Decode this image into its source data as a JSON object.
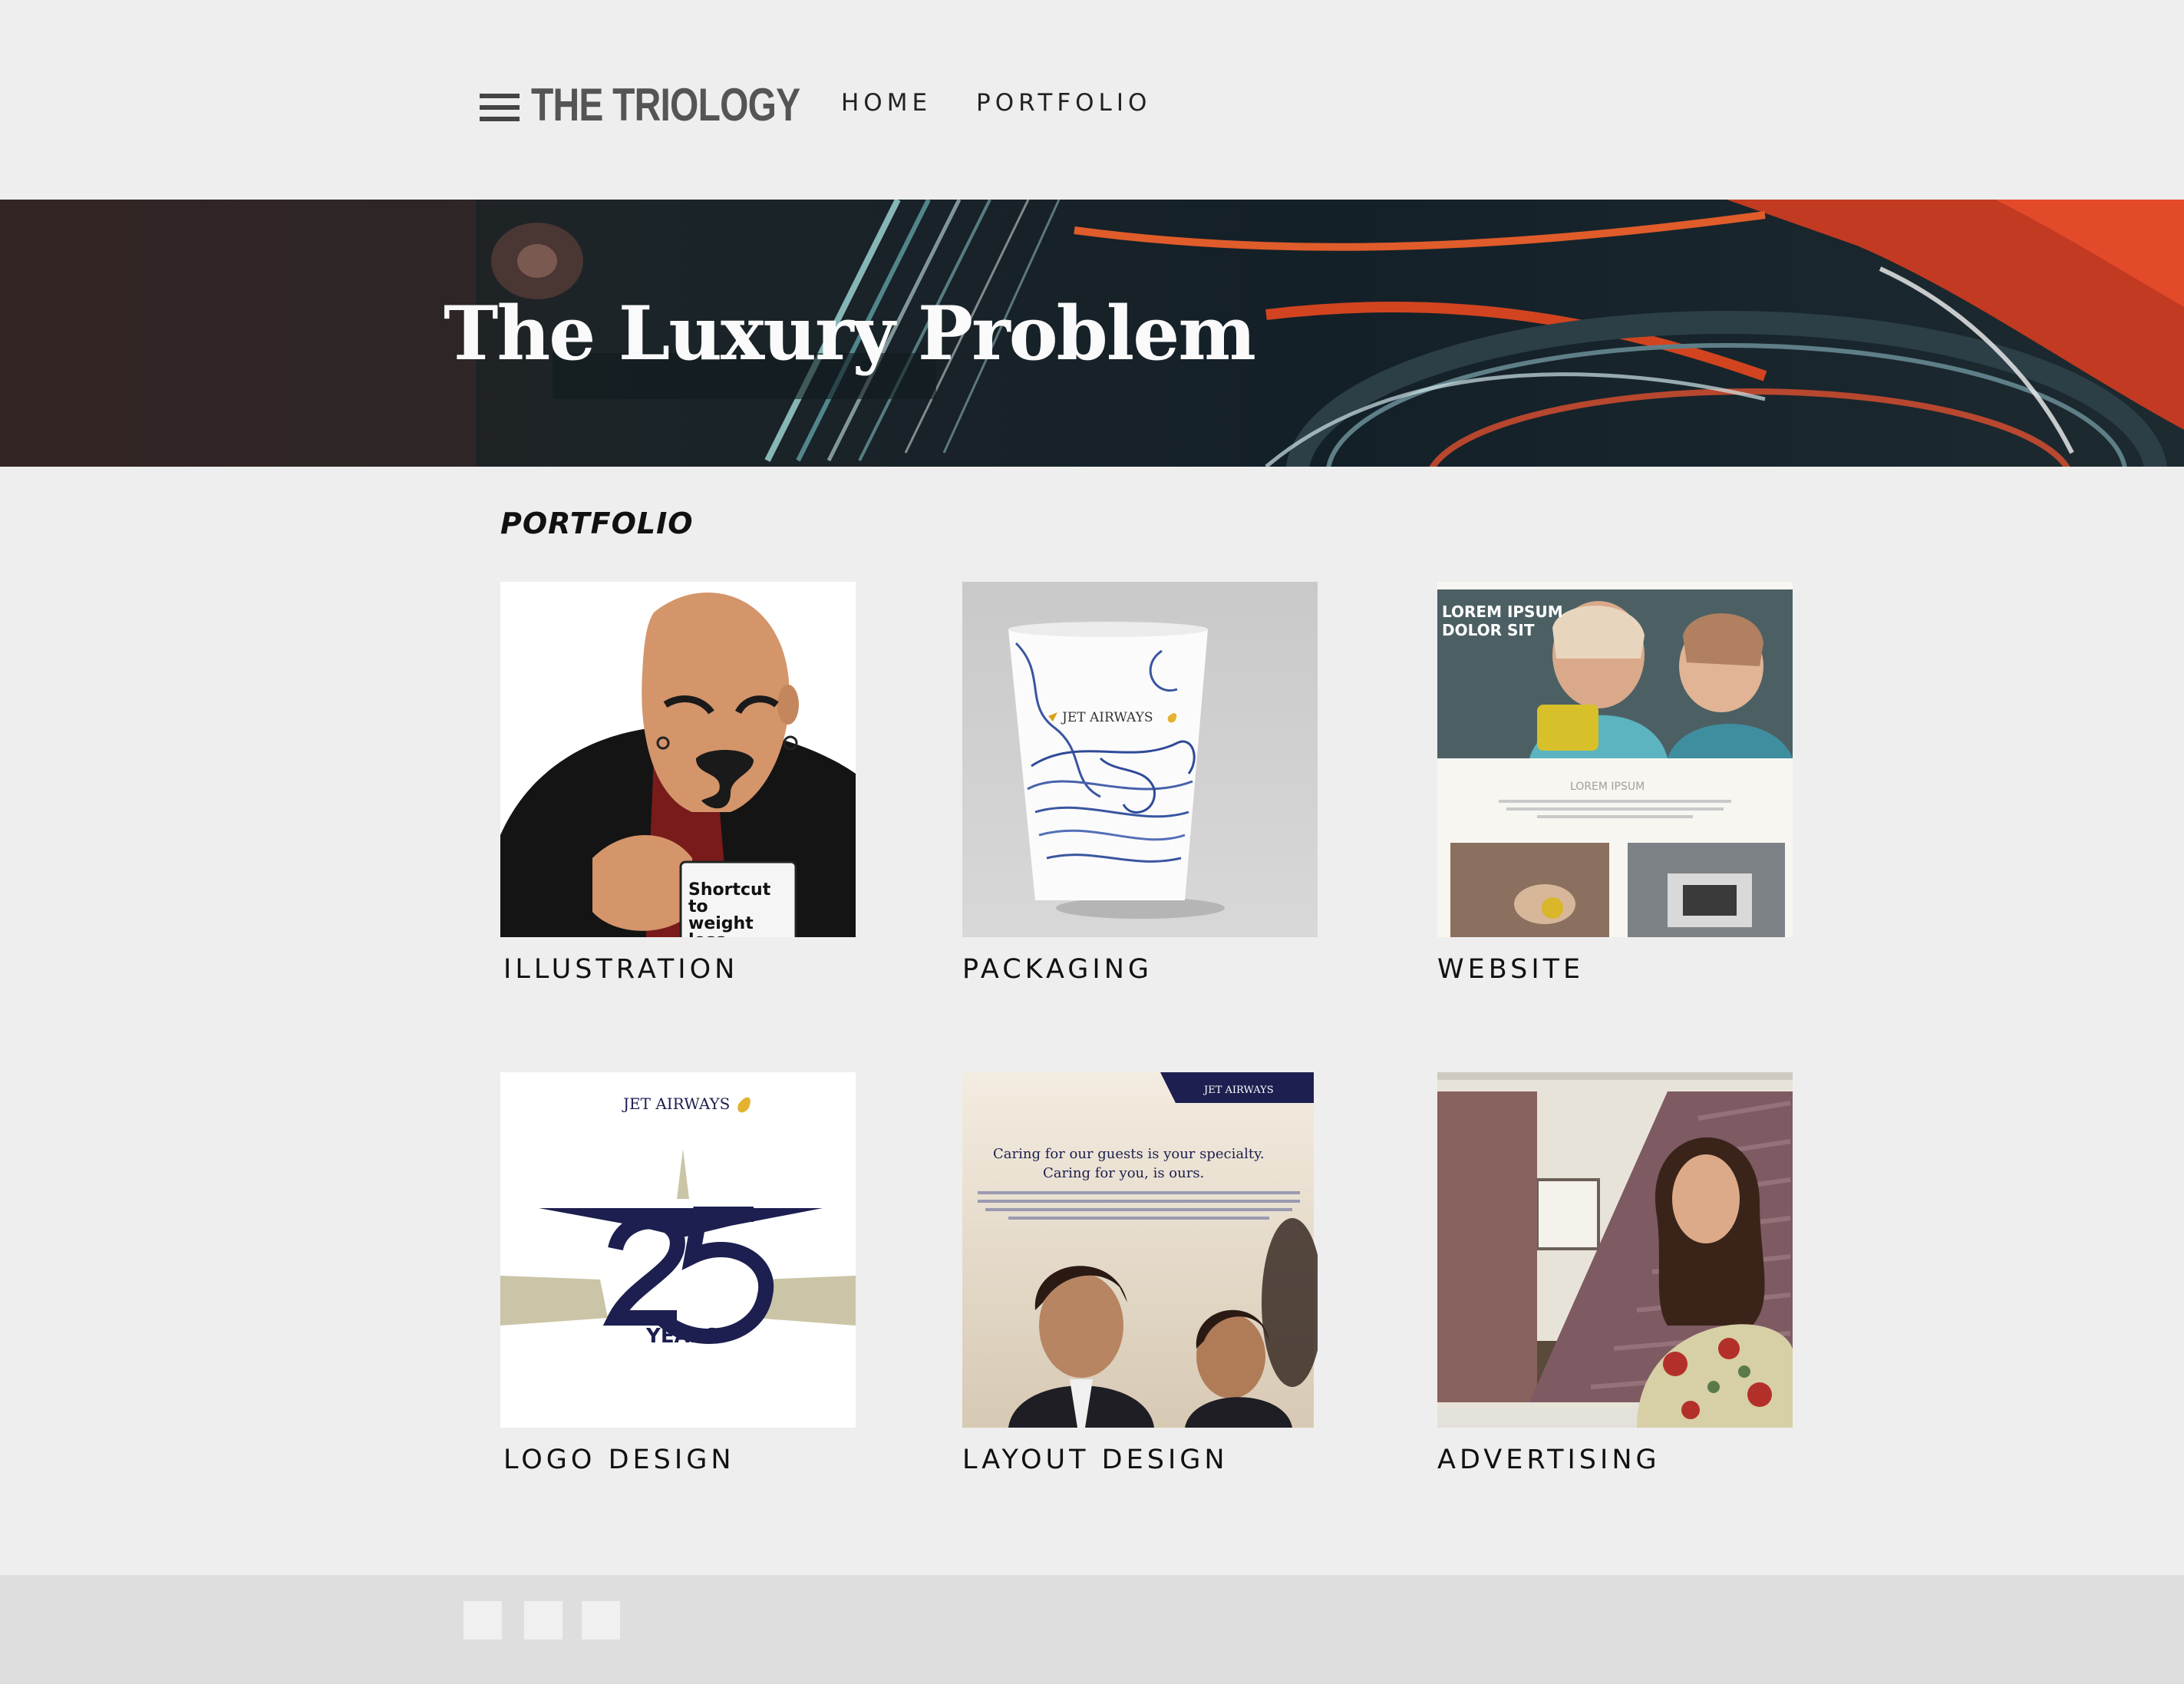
{
  "header": {
    "brand": "THE TRIOLOGY",
    "nav": [
      {
        "label": "HOME"
      },
      {
        "label": "PORTFOLIO"
      }
    ],
    "menu_icon": "hamburger-menu-icon"
  },
  "hero": {
    "title": "The Luxury Problem"
  },
  "portfolio": {
    "title": "PORTFOLIO",
    "items": [
      {
        "caption": "ILLUSTRATION",
        "mug_text": [
          "Shortcut",
          "to",
          "weight",
          "loss"
        ]
      },
      {
        "caption": "PACKAGING",
        "cup_brand": "JET AIRWAYS"
      },
      {
        "caption": "WEBSITE",
        "hero_text": [
          "LOREM IPSUM",
          "DOLOR SIT"
        ],
        "section_text": "LOREM IPSUM"
      },
      {
        "caption": "LOGO DESIGN",
        "brand": "JET AIRWAYS",
        "number": "25",
        "sub": "YEARS"
      },
      {
        "caption": "LAYOUT DESIGN",
        "brand": "JET AIRWAYS",
        "headline": [
          "Caring for our guests is your specialty.",
          "Caring for you, is ours."
        ]
      },
      {
        "caption": "ADVERTISING"
      }
    ]
  },
  "footer": {
    "social_icons": [
      "social-icon-1",
      "social-icon-2",
      "social-icon-3"
    ]
  },
  "colors": {
    "background": "#eeeeee",
    "footer": "#dedede",
    "brand_text": "#555555",
    "jet_navy": "#1c1f4f",
    "jet_gold": "#d9a21b"
  }
}
